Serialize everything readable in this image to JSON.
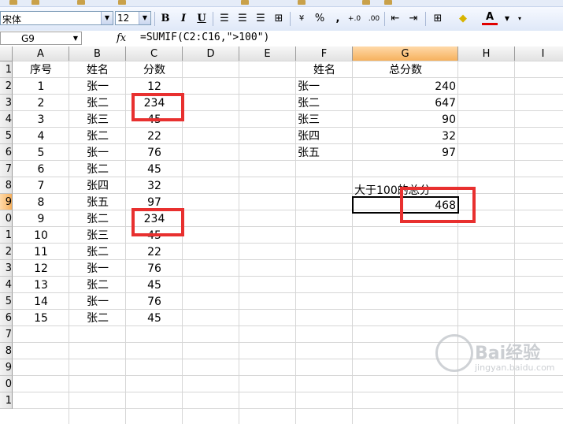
{
  "toolbar": {
    "font_name": "宋体",
    "font_size": "12",
    "bold": "B",
    "italic": "I",
    "underline": "U",
    "percent": "%",
    "comma": ",",
    "increase_decimal": "+.0",
    "decrease_decimal": ".00",
    "font_color_glyph": "A"
  },
  "formula_bar": {
    "name_box": "G9",
    "fx": "fx",
    "formula": "=SUMIF(C2:C16,\">100\")"
  },
  "columns": [
    "A",
    "B",
    "C",
    "D",
    "E",
    "F",
    "G",
    "H",
    "I"
  ],
  "selected_column": "G",
  "rows": [
    "1",
    "2",
    "3",
    "4",
    "5",
    "6",
    "7",
    "8",
    "9",
    "10",
    "11",
    "12",
    "13",
    "14",
    "15",
    "16",
    "17",
    "18",
    "19",
    "20",
    "21"
  ],
  "selected_row": "9",
  "row_labels_visible": [
    "1",
    "2",
    "3",
    "4",
    "5",
    "6",
    "7",
    "8",
    "9",
    "0",
    "1",
    "2",
    "3",
    "4",
    "5",
    "6",
    "7",
    "8",
    "9",
    "0",
    "1"
  ],
  "headers": {
    "a": "序号",
    "b": "姓名",
    "c": "分数",
    "f": "姓名",
    "g": "总分数"
  },
  "data_rows": [
    {
      "a": "1",
      "b": "张一",
      "c": "12"
    },
    {
      "a": "2",
      "b": "张二",
      "c": "234"
    },
    {
      "a": "3",
      "b": "张三",
      "c": "45"
    },
    {
      "a": "4",
      "b": "张二",
      "c": "22"
    },
    {
      "a": "5",
      "b": "张一",
      "c": "76"
    },
    {
      "a": "6",
      "b": "张二",
      "c": "45"
    },
    {
      "a": "7",
      "b": "张四",
      "c": "32"
    },
    {
      "a": "8",
      "b": "张五",
      "c": "97"
    },
    {
      "a": "9",
      "b": "张二",
      "c": "234"
    },
    {
      "a": "10",
      "b": "张三",
      "c": "45"
    },
    {
      "a": "11",
      "b": "张二",
      "c": "22"
    },
    {
      "a": "12",
      "b": "张一",
      "c": "76"
    },
    {
      "a": "13",
      "b": "张二",
      "c": "45"
    },
    {
      "a": "14",
      "b": "张一",
      "c": "76"
    },
    {
      "a": "15",
      "b": "张二",
      "c": "45"
    }
  ],
  "summary": [
    {
      "name": "张一",
      "total": "240"
    },
    {
      "name": "张二",
      "total": "647"
    },
    {
      "name": "张三",
      "total": "90"
    },
    {
      "name": "张四",
      "total": "32"
    },
    {
      "name": "张五",
      "total": "97"
    }
  ],
  "label_over_100": "大于100的总分",
  "result_value": "468",
  "watermark": {
    "text": "Bai经验",
    "url": "jingyan.baidu.com"
  },
  "colors": {
    "highlight_box": "#e8302f",
    "selected_header": "#f6b15e"
  }
}
